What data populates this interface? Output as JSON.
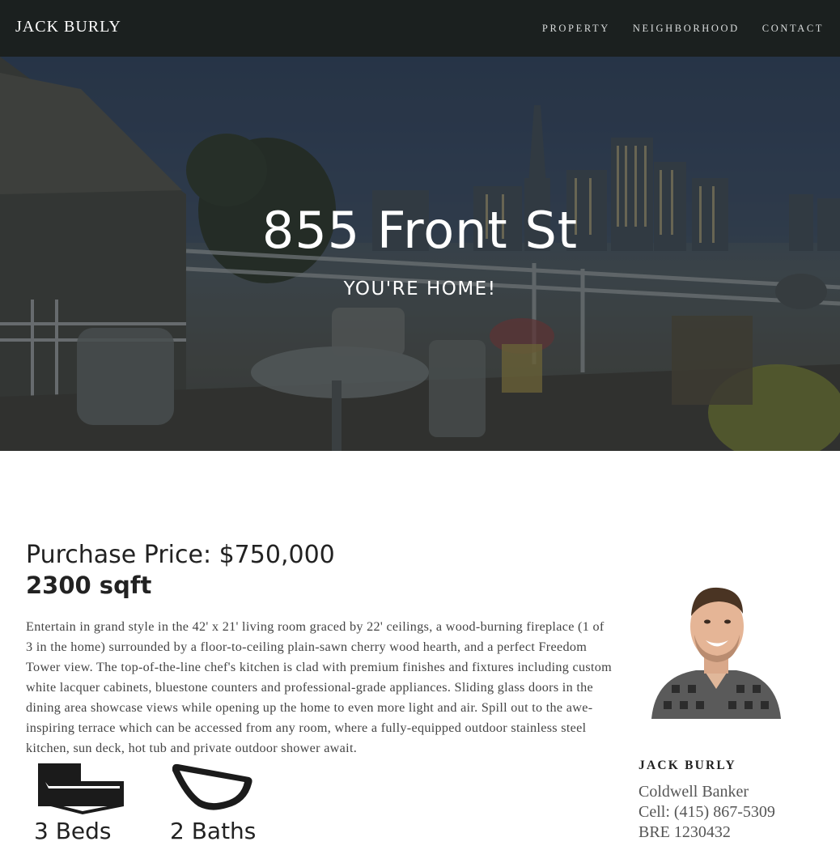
{
  "nav": {
    "brand": "JACK BURLY",
    "links": [
      "PROPERTY",
      "NEIGHBORHOOD",
      "CONTACT"
    ]
  },
  "hero": {
    "title": "855 Front St",
    "subtitle": "YOU'RE HOME!"
  },
  "listing": {
    "price": "Purchase Price: $750,000",
    "sqft": "2300 sqft",
    "description": "Entertain in grand style in the 42' x 21' living room graced by 22' ceilings, a wood-burning fireplace (1 of 3 in the home) surrounded by a floor-to-ceiling plain-sawn cherry wood hearth, and a perfect Freedom Tower view. The top-of-the-line chef's kitchen is clad with premium finishes and fixtures including custom white lacquer cabinets, bluestone counters and professional-grade appliances. Sliding glass doors in the dining area showcase views while opening up the home to even more light and air. Spill out to the awe-inspiring terrace which can be accessed from any room, where a fully-equipped outdoor stainless steel kitchen, sun deck, hot tub and private outdoor shower await.",
    "features": [
      {
        "icon": "bed-icon",
        "label": "3 Beds"
      },
      {
        "icon": "bathtub-icon",
        "label": "2 Baths"
      }
    ]
  },
  "agent": {
    "name": "JACK BURLY",
    "company": "Coldwell Banker",
    "cell": "Cell: (415) 867-5309",
    "license": "BRE 1230432"
  },
  "colors": {
    "navbar": "#1b201f",
    "text_dark": "#222222",
    "text_body": "#444444"
  }
}
